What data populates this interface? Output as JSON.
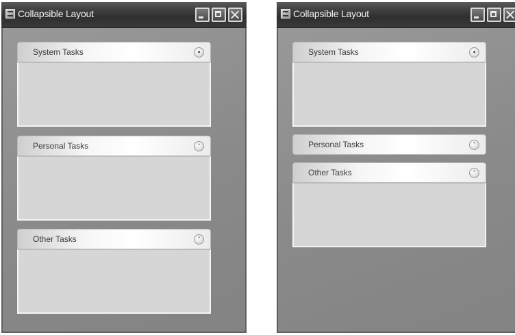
{
  "windows": [
    {
      "title": "Collapsible Layout",
      "panels": [
        {
          "title": "System Tasks",
          "toggle_icon": "•"
        },
        {
          "title": "Personal Tasks",
          "toggle_icon": "˄"
        },
        {
          "title": "Other Tasks",
          "toggle_icon": "˅"
        }
      ]
    },
    {
      "title": "Collapsible Layout",
      "panels": [
        {
          "title": "System Tasks",
          "toggle_icon": "•"
        },
        {
          "title": "Personal Tasks",
          "toggle_icon": "˅"
        },
        {
          "title": "Other Tasks",
          "toggle_icon": "˄"
        }
      ]
    }
  ]
}
